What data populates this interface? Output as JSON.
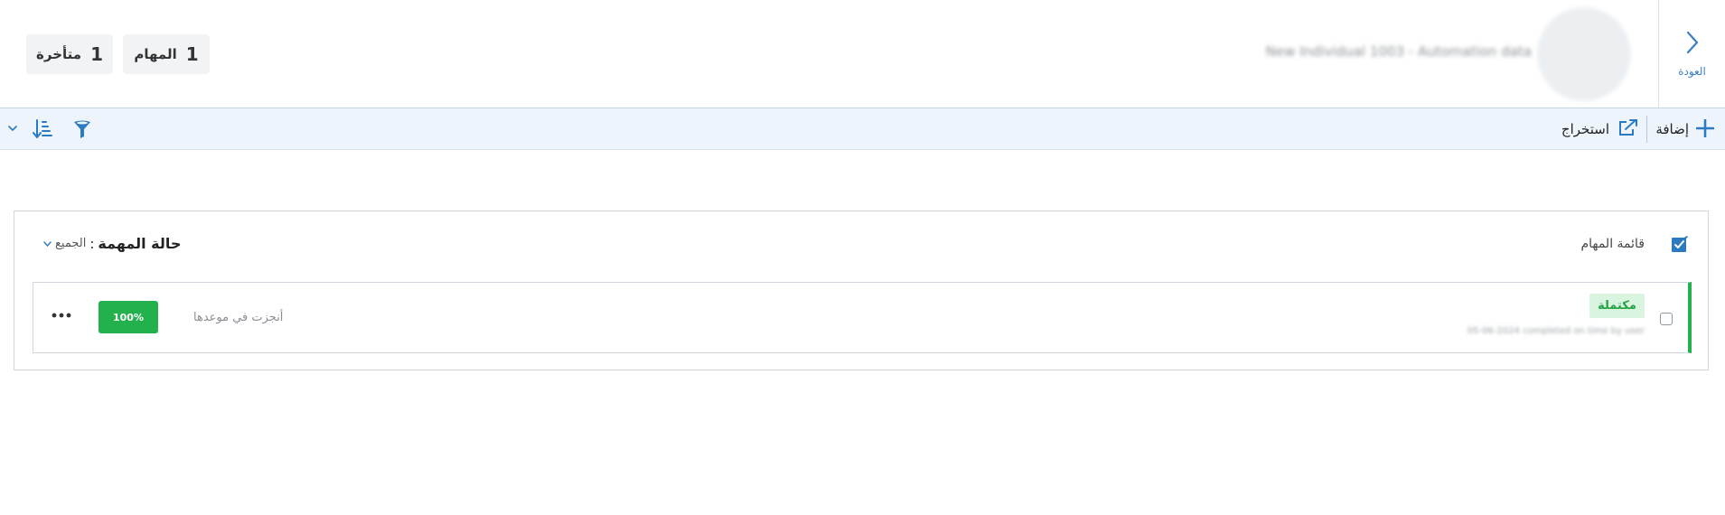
{
  "header": {
    "back_label": "العودة",
    "entity_name": "New Individual 1003 - Automation data",
    "counters": {
      "tasks": {
        "count": "1",
        "label": "المهام"
      },
      "late": {
        "count": "1",
        "label": "متأخرة"
      }
    }
  },
  "toolbar": {
    "add_label": "إضافة",
    "export_label": "استخراج",
    "icons": [
      "plus-icon",
      "export-icon",
      "filter-icon",
      "sort-icon",
      "chevron-down-icon"
    ],
    "accent_color": "#2b7bc2"
  },
  "panel": {
    "title": "قائمة المهام",
    "status_filter": {
      "label": "حالة المهمة",
      "colon": ":",
      "value": "الجميع"
    }
  },
  "tasks": [
    {
      "status_badge": "مكتملة",
      "subtitle": "05-06-2024 completed on time by user",
      "timeliness": "أنجزت في موعدها",
      "progress_label": "100%",
      "progress": 1.0,
      "status_color": "#22b14c"
    }
  ]
}
